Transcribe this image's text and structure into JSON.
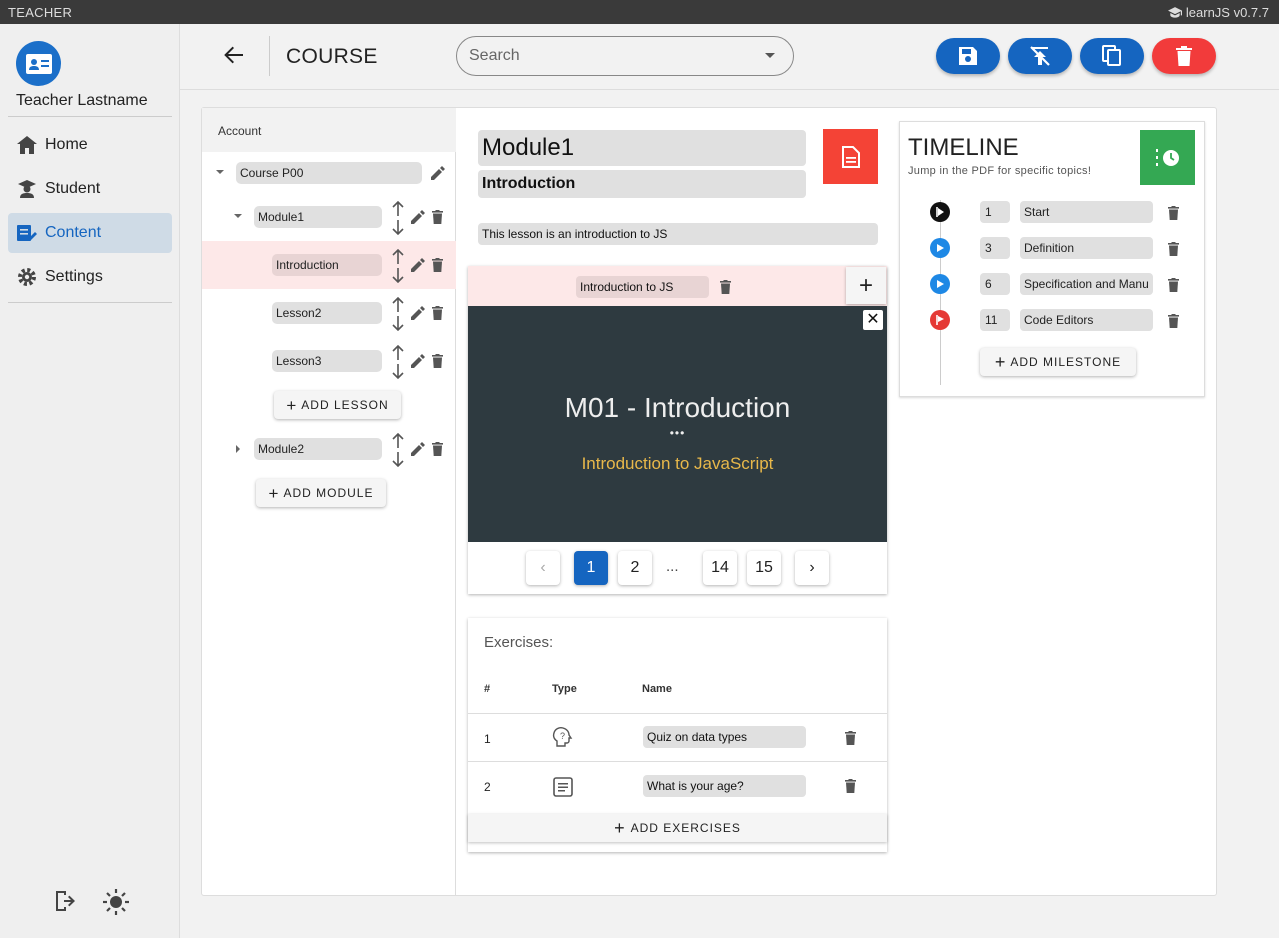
{
  "app": {
    "mode": "TEACHER",
    "brand": "learnJS v0.7.7"
  },
  "user": {
    "name": "Teacher Lastname"
  },
  "nav": [
    {
      "label": "Home",
      "icon": "home-icon"
    },
    {
      "label": "Student",
      "icon": "student-icon"
    },
    {
      "label": "Content",
      "icon": "content-edit-icon",
      "active": true
    },
    {
      "label": "Settings",
      "icon": "gear-icon"
    }
  ],
  "header": {
    "title": "COURSE",
    "search_placeholder": "Search"
  },
  "tree": {
    "header": "Account",
    "course": "Course P00",
    "module1": "Module1",
    "lessons": [
      "Introduction",
      "Lesson2",
      "Lesson3"
    ],
    "add_lesson": "ADD LESSON",
    "module2": "Module2",
    "add_module": "ADD MODULE"
  },
  "lesson": {
    "module_title": "Module1",
    "lesson_title": "Introduction",
    "description": "This lesson is an introduction to JS",
    "pdf_name": "Introduction to JS",
    "slide_title": "M01 - Introduction",
    "slide_dots": "•••",
    "slide_subtitle": "Introduction to JavaScript",
    "pages": [
      "1",
      "2",
      "...",
      "14",
      "15"
    ],
    "current_page": "1"
  },
  "exercises": {
    "title": "Exercises:",
    "headers": [
      "#",
      "Type",
      "Name"
    ],
    "rows": [
      {
        "num": "1",
        "type": "quiz-icon",
        "name": "Quiz on data types"
      },
      {
        "num": "2",
        "type": "text-icon",
        "name": "What is your age?"
      }
    ],
    "add_label": "ADD EXERCISES"
  },
  "timeline": {
    "title": "TIMELINE",
    "subtitle": "Jump in the PDF for specific topics!",
    "items": [
      {
        "page": "1",
        "name": "Start",
        "kind": "start"
      },
      {
        "page": "3",
        "name": "Definition",
        "kind": "play"
      },
      {
        "page": "6",
        "name": "Specification and Manu",
        "kind": "play"
      },
      {
        "page": "11",
        "name": "Code Editors",
        "kind": "end"
      }
    ],
    "add_label": "ADD MILESTONE"
  },
  "colors": {
    "primary": "#1565c0",
    "danger": "#f44336",
    "success": "#34a853",
    "slide_bg": "#2e3a40",
    "slide_accent": "#e8b84a"
  }
}
